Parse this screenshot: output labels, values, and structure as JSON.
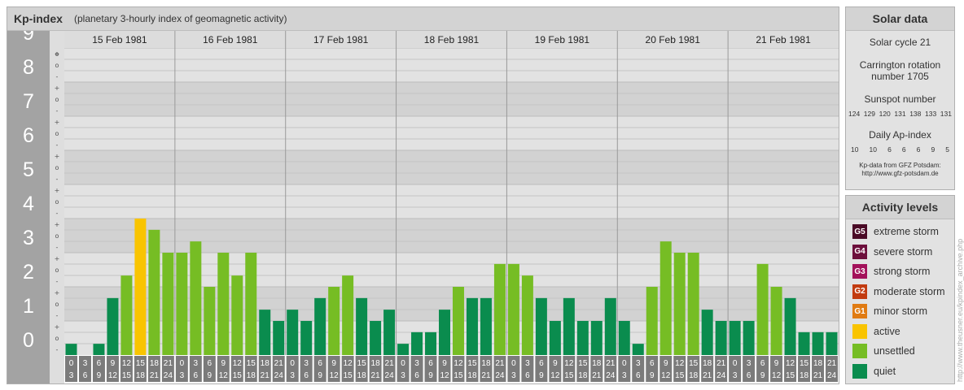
{
  "header": {
    "title": "Kp-index",
    "subtitle": "(planetary 3-hourly index of geomagnetic activity)"
  },
  "chart_data": {
    "type": "bar",
    "days": [
      "15 Feb 1981",
      "16 Feb 1981",
      "17 Feb 1981",
      "18 Feb 1981",
      "19 Feb 1981",
      "20 Feb 1981",
      "21 Feb 1981"
    ],
    "interval_starts": [
      "0",
      "3",
      "6",
      "9",
      "12",
      "15",
      "18",
      "21"
    ],
    "interval_ends": [
      "3",
      "6",
      "9",
      "12",
      "15",
      "18",
      "21",
      "24"
    ],
    "y_ticks": [
      "0",
      "1",
      "2",
      "3",
      "4",
      "5",
      "6",
      "7",
      "8",
      "9"
    ],
    "sub_ticks": [
      "-",
      "o",
      "+"
    ],
    "ylim": [
      0,
      9
    ],
    "values": [
      0.33,
      0.0,
      0.33,
      1.67,
      2.33,
      4.0,
      3.67,
      3.0,
      3.0,
      3.33,
      2.0,
      3.0,
      2.33,
      3.0,
      1.33,
      1.0,
      1.33,
      1.0,
      1.67,
      2.0,
      2.33,
      1.67,
      1.0,
      1.33,
      0.33,
      0.67,
      0.67,
      1.33,
      2.0,
      1.67,
      1.67,
      2.67,
      2.67,
      2.33,
      1.67,
      1.0,
      1.67,
      1.0,
      1.0,
      1.67,
      1.0,
      0.33,
      2.0,
      3.33,
      3.0,
      3.0,
      1.33,
      1.0,
      1.0,
      1.0,
      2.67,
      2.0,
      1.67,
      0.67,
      0.67,
      0.67
    ],
    "colors": {
      "quiet": "#0a8c4e",
      "unsettled": "#76bd24",
      "active": "#f9c400",
      "minor": "#e07b12",
      "moderate": "#c23b10",
      "strong": "#a3115a",
      "severe": "#6d0f3c",
      "extreme": "#4a0a26"
    },
    "legend": [
      {
        "badge": "G5",
        "label": "extreme storm",
        "color": "#4a0a26"
      },
      {
        "badge": "G4",
        "label": "severe storm",
        "color": "#6d0f3c"
      },
      {
        "badge": "G3",
        "label": "strong storm",
        "color": "#a3115a"
      },
      {
        "badge": "G2",
        "label": "moderate storm",
        "color": "#c23b10"
      },
      {
        "badge": "G1",
        "label": "minor storm",
        "color": "#e07b12"
      },
      {
        "badge": "",
        "label": "active",
        "color": "#f9c400"
      },
      {
        "badge": "",
        "label": "unsettled",
        "color": "#76bd24"
      },
      {
        "badge": "",
        "label": "quiet",
        "color": "#0a8c4e"
      }
    ]
  },
  "solar": {
    "title": "Solar data",
    "cycle": "Solar cycle 21",
    "carrington_1": "Carrington rotation",
    "carrington_2": "number 1705",
    "sunspot_label": "Sunspot number",
    "sunspots": [
      "124",
      "129",
      "120",
      "131",
      "138",
      "133",
      "131"
    ],
    "ap_label": "Daily Ap-index",
    "ap": [
      "10",
      "10",
      "6",
      "6",
      "6",
      "9",
      "5"
    ],
    "foot_1": "Kp-data from GFZ Potsdam:",
    "foot_2": "http://www.gfz-potsdam.de"
  },
  "levels": {
    "title": "Activity levels"
  },
  "watermark": "http://www.theusner.eu/kpindex_archive.php"
}
